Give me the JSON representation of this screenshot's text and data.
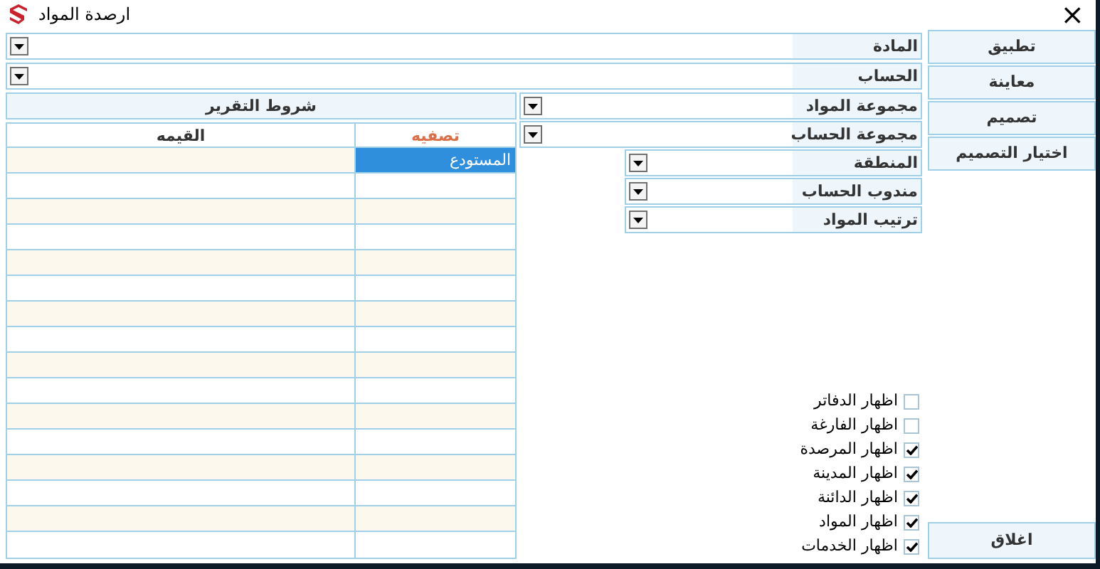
{
  "window": {
    "title": "ارصدة المواد",
    "close": "×"
  },
  "top_fields": [
    {
      "label": "المادة"
    },
    {
      "label": "الحساب"
    }
  ],
  "side_fields": [
    {
      "label": "مجموعة المواد",
      "indent": false
    },
    {
      "label": "مجموعة الحساب",
      "indent": false
    },
    {
      "label": "المنطقة",
      "indent": true
    },
    {
      "label": "مندوب الحساب",
      "indent": true
    },
    {
      "label": "ترتيب المواد",
      "indent": true
    }
  ],
  "grid": {
    "title": "شروط التقرير",
    "columns": [
      "تصفيه",
      "القيمه"
    ],
    "rows": [
      {
        "filter": "المستودع",
        "selected": true
      },
      {
        "selected": false
      },
      {
        "selected": false
      },
      {
        "selected": false
      },
      {
        "selected": false
      },
      {
        "selected": false
      },
      {
        "selected": false
      },
      {
        "selected": false
      },
      {
        "selected": false
      },
      {
        "selected": false
      },
      {
        "selected": false
      },
      {
        "selected": false
      },
      {
        "selected": false
      },
      {
        "selected": false
      },
      {
        "selected": false
      },
      {
        "selected": false
      }
    ]
  },
  "options": [
    {
      "label": "اظهار الدفاتر",
      "checked": false
    },
    {
      "label": "اظهار الفارغة",
      "checked": false
    },
    {
      "label": "اظهار المرصدة",
      "checked": true
    },
    {
      "label": "اظهار المدينة",
      "checked": true
    },
    {
      "label": "اظهار الدائنة",
      "checked": true
    },
    {
      "label": "اظهار المواد",
      "checked": true
    },
    {
      "label": "اظهار الخدمات",
      "checked": true
    }
  ],
  "buttons": [
    "تطبيق",
    "معاينة",
    "تصميم",
    "اختيار التصميم"
  ],
  "close_button": "اغلاق"
}
